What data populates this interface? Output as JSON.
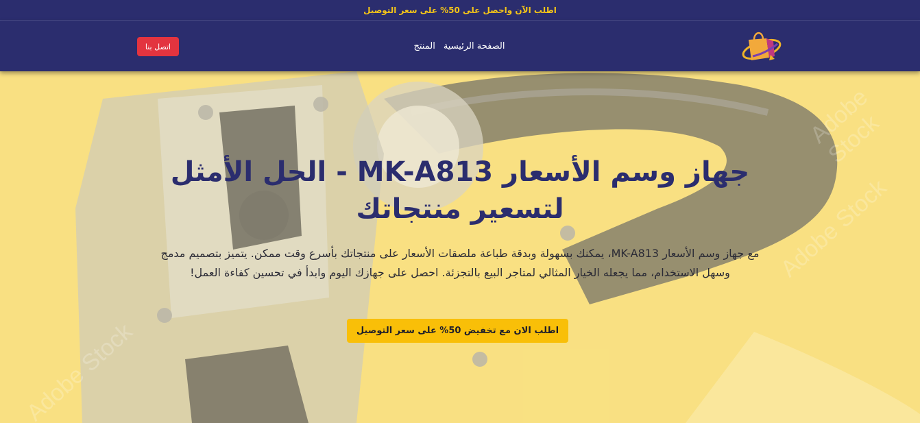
{
  "announcement": {
    "text": "اطلب الآن واحصل على 50% على سعر التوصيل"
  },
  "nav": {
    "links": [
      {
        "label": "الصفحة الرئيسية"
      },
      {
        "label": "المنتج"
      }
    ],
    "contact_label": "اتصل بنا"
  },
  "hero": {
    "title": "جهاز وسم الأسعار MK-A813 - الحل الأمثل لتسعير منتجاتك",
    "description": "مع جهاز وسم الأسعار MK-A813، يمكنك بسهولة وبدقة طباعة ملصقات الأسعار على منتجاتك بأسرع وقت ممكن. يتميز بتصميم مدمج وسهل الاستخدام، مما يجعله الخيار المثالي لمتاجر البيع بالتجزئة. احصل على جهازك اليوم وابدأ في تحسين كفاءة العمل!",
    "cta_label": "اطلب الان مع تخفيض 50% على سعر التوصيل",
    "watermark": "Adobe Stock"
  },
  "colors": {
    "navy": "#2b2d6e",
    "accent_yellow": "#f9bf08",
    "contact_red": "#e3343f",
    "announcement_text": "#f5c518"
  },
  "icons": {
    "logo": "shopping-bag-logo-icon"
  }
}
